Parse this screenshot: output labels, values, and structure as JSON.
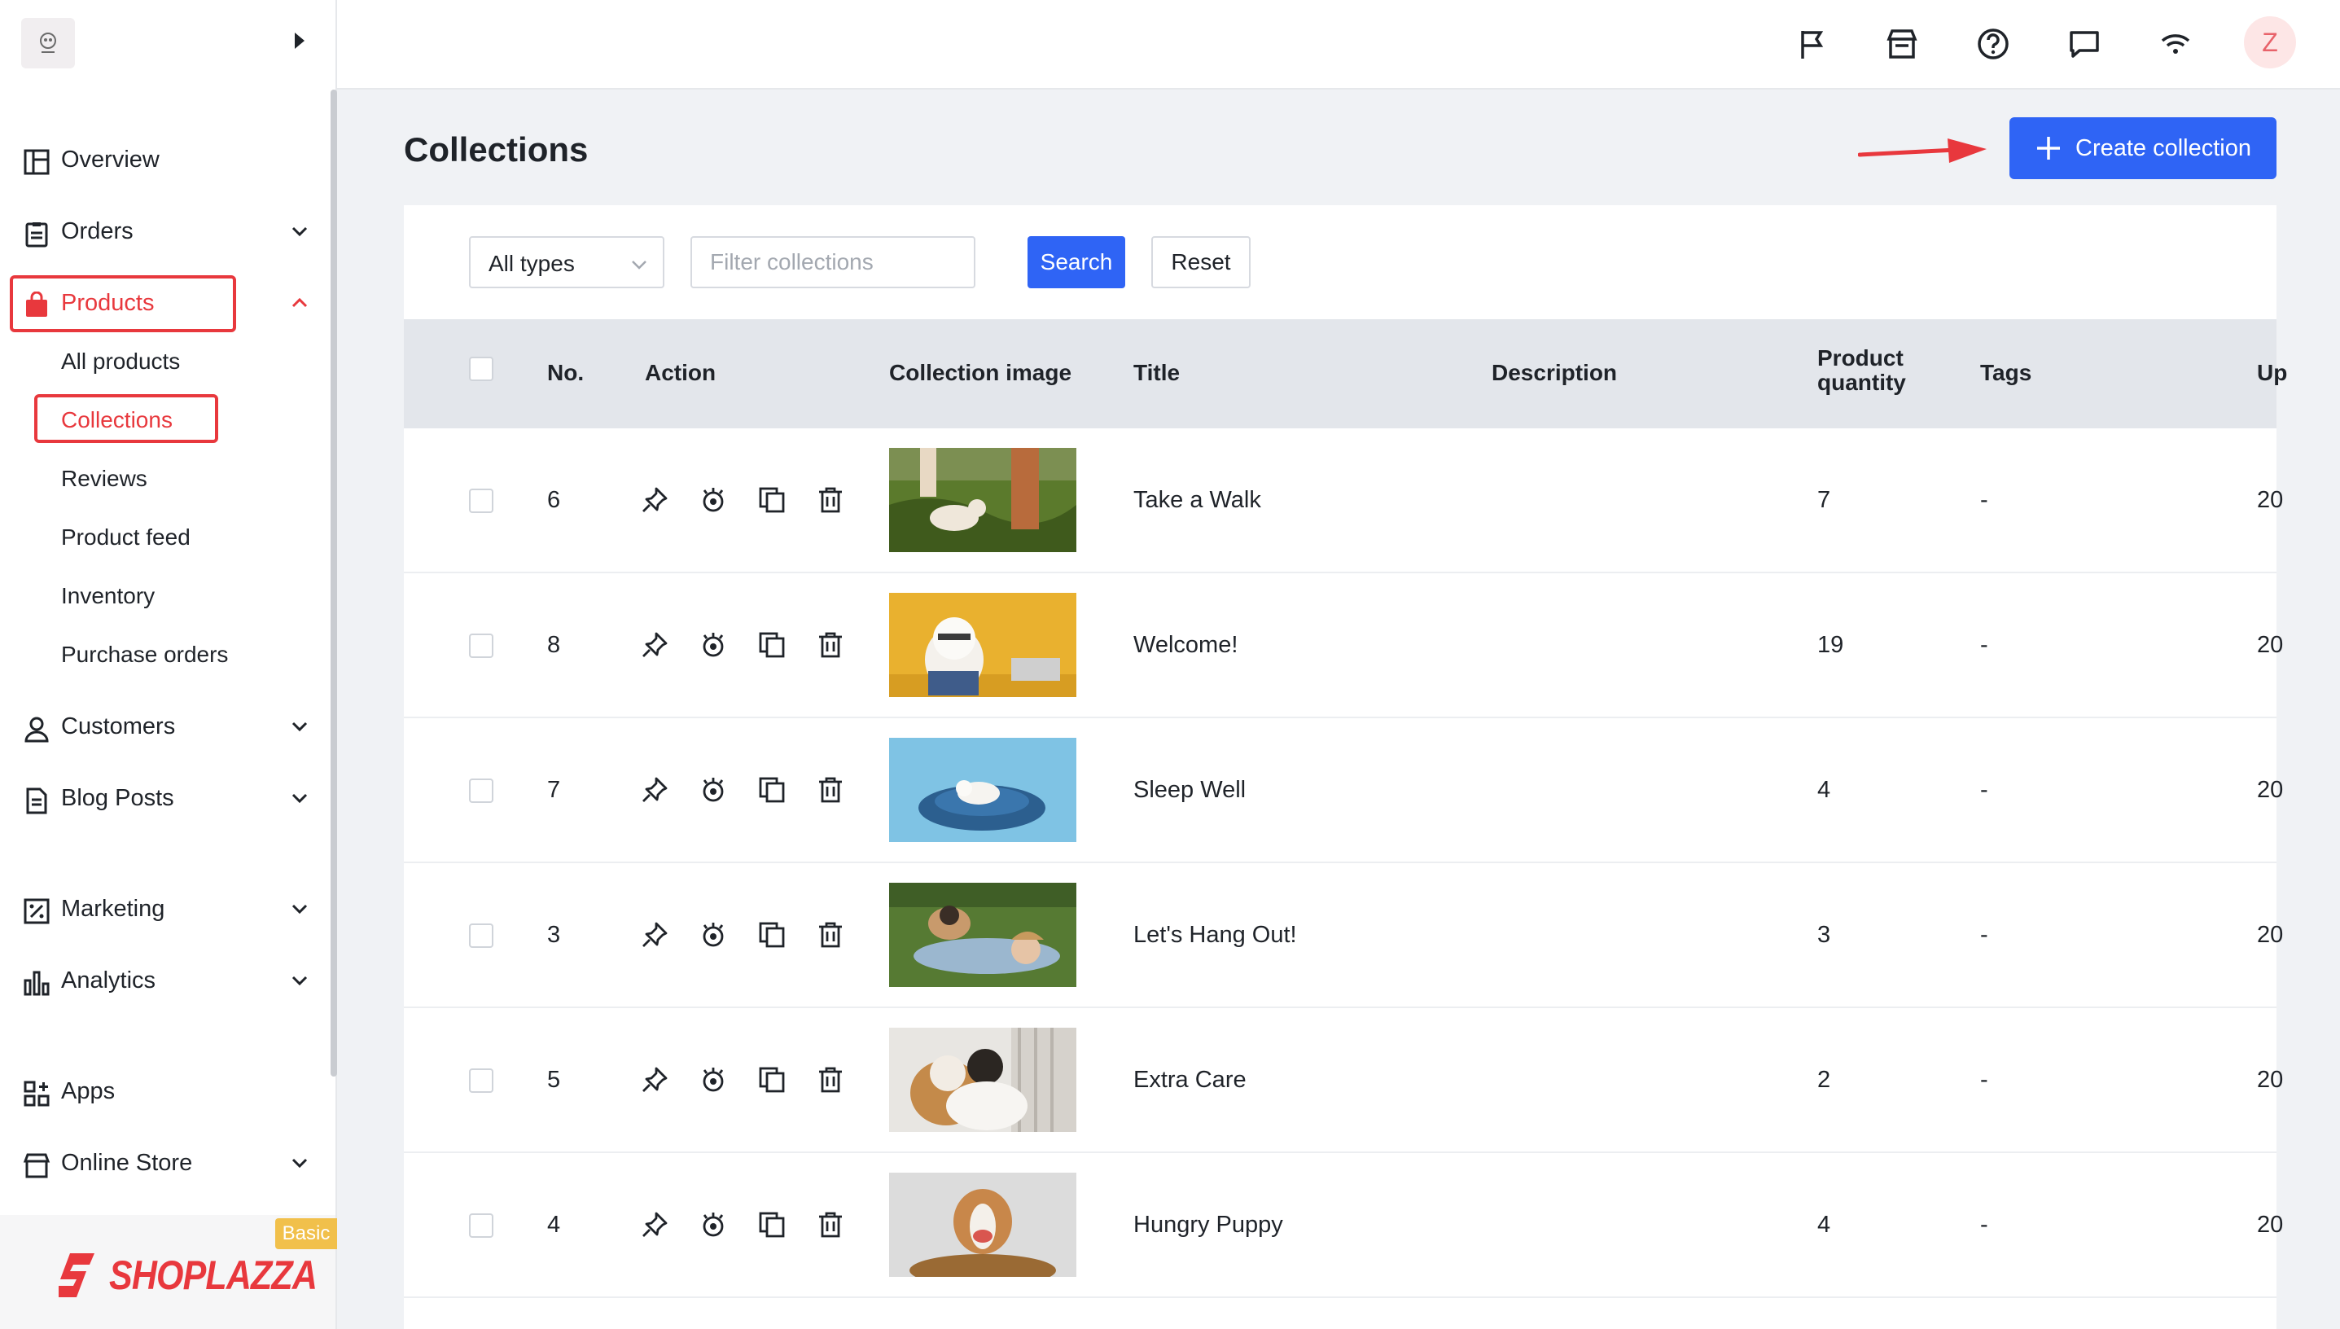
{
  "sidebar": {
    "nav": [
      {
        "label": "Overview",
        "icon": "dashboard-icon"
      },
      {
        "label": "Orders",
        "icon": "clipboard-icon"
      },
      {
        "label": "Products",
        "icon": "shopping-bag-icon"
      },
      {
        "label": "Customers",
        "icon": "person-icon"
      },
      {
        "label": "Blog Posts",
        "icon": "document-icon"
      },
      {
        "label": "Marketing",
        "icon": "discount-icon"
      },
      {
        "label": "Analytics",
        "icon": "bar-chart-icon"
      },
      {
        "label": "Apps",
        "icon": "apps-grid-icon"
      },
      {
        "label": "Online Store",
        "icon": "store-icon"
      }
    ],
    "products_sub": [
      "All products",
      "Collections",
      "Reviews",
      "Product feed",
      "Inventory",
      "Purchase orders"
    ],
    "badge": "Basic",
    "brand": "SHOPLAZZA"
  },
  "header": {
    "icons": [
      "flag-icon",
      "store-icon",
      "help-icon",
      "chat-icon",
      "wifi-icon"
    ],
    "avatar_letter": "Z"
  },
  "page": {
    "title": "Collections",
    "create_label": "Create collection"
  },
  "filters": {
    "type_value": "All types",
    "filter_placeholder": "Filter collections",
    "search_label": "Search",
    "reset_label": "Reset"
  },
  "table": {
    "columns": {
      "no": "No.",
      "action": "Action",
      "image": "Collection image",
      "title": "Title",
      "description": "Description",
      "qty_line1": "Product",
      "qty_line2": "quantity",
      "tags": "Tags",
      "updated": "Up"
    },
    "rows": [
      {
        "no": "6",
        "title": "Take a Walk",
        "description": "",
        "qty": "7",
        "tags": "-",
        "updated": "20"
      },
      {
        "no": "8",
        "title": "Welcome!",
        "description": "",
        "qty": "19",
        "tags": "-",
        "updated": "20"
      },
      {
        "no": "7",
        "title": "Sleep Well",
        "description": "",
        "qty": "4",
        "tags": "-",
        "updated": "20"
      },
      {
        "no": "3",
        "title": "Let's Hang Out!",
        "description": "",
        "qty": "3",
        "tags": "-",
        "updated": "20"
      },
      {
        "no": "5",
        "title": "Extra Care",
        "description": "",
        "qty": "2",
        "tags": "-",
        "updated": "20"
      },
      {
        "no": "4",
        "title": "Hungry Puppy",
        "description": "",
        "qty": "4",
        "tags": "-",
        "updated": "20"
      }
    ]
  },
  "colors": {
    "accent": "#2f64f5",
    "active": "#e8383d",
    "badge": "#f1c04b"
  }
}
